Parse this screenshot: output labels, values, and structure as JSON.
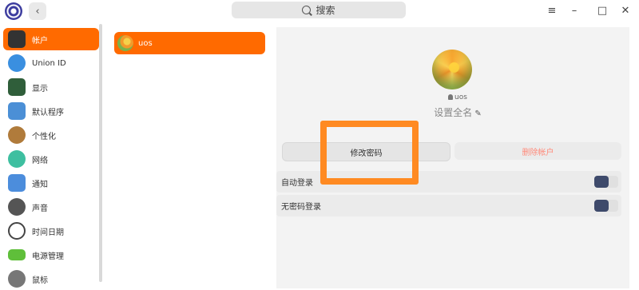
{
  "titlebar": {
    "search_label": "搜索",
    "back_icon": "chevron-left-icon",
    "menu_icon": "≡",
    "minimize_icon": "–",
    "maximize_icon": "□",
    "close_icon": "✕"
  },
  "sidebar": {
    "items": [
      {
        "label": "帐户",
        "icon": "account-icon",
        "color": "#333333"
      },
      {
        "label": "Union ID",
        "icon": "cloud-icon",
        "color": "#3a8fe0"
      },
      {
        "label": "显示",
        "icon": "monitor-icon",
        "color": "#2f5e3a"
      },
      {
        "label": "默认程序",
        "icon": "default-apps-icon",
        "color": "#4b8fd6"
      },
      {
        "label": "个性化",
        "icon": "palette-icon",
        "color": "#b07b3b"
      },
      {
        "label": "网络",
        "icon": "network-icon",
        "color": "#3ebfa0"
      },
      {
        "label": "通知",
        "icon": "notification-icon",
        "color": "#4c8ddc"
      },
      {
        "label": "声音",
        "icon": "speaker-icon",
        "color": "#555555"
      },
      {
        "label": "时间日期",
        "icon": "clock-icon",
        "color": "#444444"
      },
      {
        "label": "电源管理",
        "icon": "battery-icon",
        "color": "#5fbf3a"
      },
      {
        "label": "鼠标",
        "icon": "mouse-icon",
        "color": "#777777"
      }
    ]
  },
  "accounts": [
    {
      "name": "uos"
    }
  ],
  "detail": {
    "username": "uos",
    "fullname_placeholder": "设置全名",
    "change_password_label": "修改密码",
    "delete_account_label": "删除帐户",
    "auto_login_label": "自动登录",
    "passwordless_login_label": "无密码登录",
    "auto_login_enabled": false,
    "passwordless_login_enabled": false
  },
  "colors": {
    "accent": "#ff6a00",
    "highlight": "#ff8a22",
    "toggle_knob": "#3e4a6b",
    "delete_text": "#ff8a7a"
  }
}
